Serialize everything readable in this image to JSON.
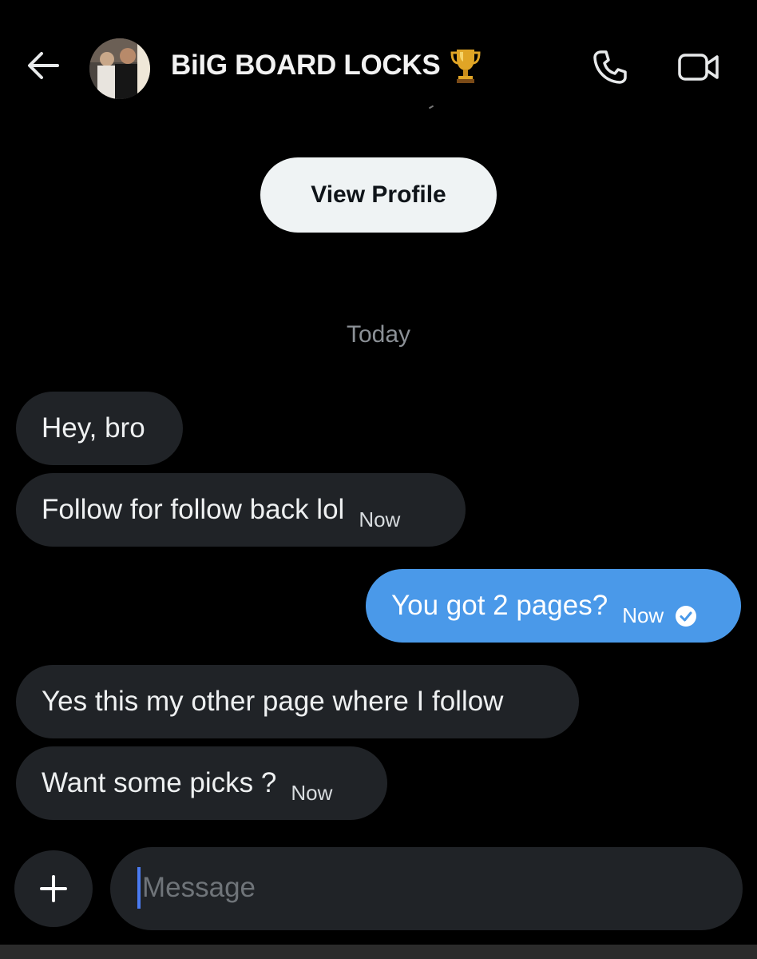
{
  "header": {
    "title": "BiIG BOARD LOCKS",
    "title_emoji": "trophy",
    "icons": [
      "back-arrow-icon",
      "phone-icon",
      "video-camera-icon",
      "trophy-icon"
    ]
  },
  "profile_button": {
    "label": "View Profile"
  },
  "date_separator": "Today",
  "messages": [
    {
      "text": "Hey, bro",
      "time": "",
      "direction": "incoming"
    },
    {
      "text": "Follow for follow back lol",
      "time": "Now",
      "direction": "incoming"
    },
    {
      "text": "You got 2 pages?",
      "time": "Now",
      "direction": "outgoing",
      "status": "read"
    },
    {
      "text": "Yes this my other page where I follow",
      "time": "",
      "direction": "incoming"
    },
    {
      "text": "Want some picks ?",
      "time": "Now",
      "direction": "incoming"
    }
  ],
  "composer": {
    "placeholder": "Message",
    "value": ""
  },
  "colors": {
    "background": "#000000",
    "incoming_bubble": "#202327",
    "outgoing_bubble": "#4a99e9",
    "button_light": "#eff3f4",
    "caret": "#4a7bf2"
  }
}
